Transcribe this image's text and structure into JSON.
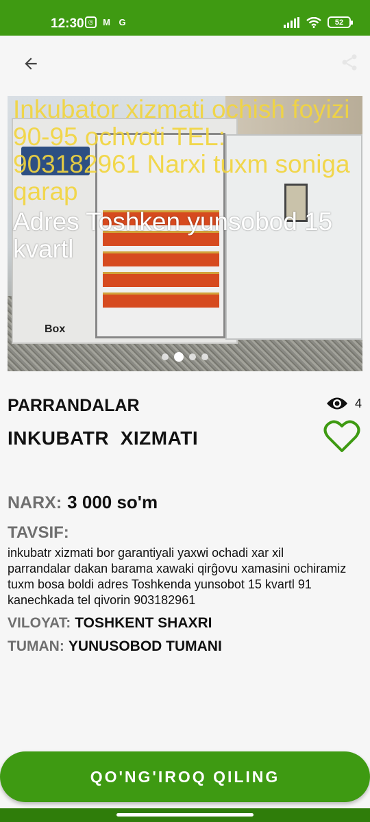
{
  "status_bar": {
    "time": "12:30",
    "app_icons": [
      "instagram-icon",
      "gmail-icon",
      "google-icon"
    ],
    "battery": "52"
  },
  "colors": {
    "brand_green": "#3f9a12",
    "text": "#111111",
    "label_gray": "#6f6f6f"
  },
  "photo": {
    "overlay_text_yellow": "Inkubator xizmati ochish foyizi 90-95 ochvoti TEL: 903182961 Narxi tuxm soniga qarap",
    "overlay_text_white": "Adres Toshken yunsobod 15 kvartl",
    "brand_text": "Box",
    "slides_total": 4,
    "active_slide": 2
  },
  "listing": {
    "category": "PARRANDALAR",
    "title": "INKUBATR  XIZMATI",
    "views": "4",
    "price_label": "NARX:",
    "price": "3 000 so'm",
    "description_label": "TAVSIF:",
    "description": "inkubatr xizmati bor garantiyali yaxwi ochadi xar xil parrandalar dakan barama xawaki qirĝovu xamasini ochiramiz tuxm bosa boldi adres Toshkenda yunsobot 15 kvartl 91 kanechkada tel qivorin 903182961",
    "region_label": "VILOYAT:",
    "region": "TOSHKENT SHAXRI",
    "district_label": "TUMAN:",
    "district": "YUNUSOBOD TUMANI"
  },
  "actions": {
    "call_label": "QO'NG'IROQ QILING"
  }
}
